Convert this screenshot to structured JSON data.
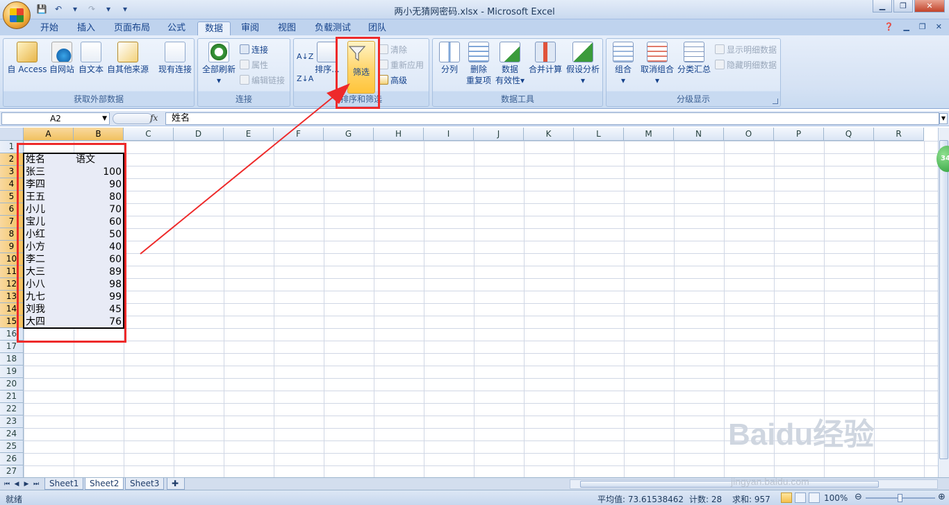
{
  "window": {
    "title": "两小无猜网密码.xlsx - Microsoft Excel",
    "controls": [
      "▁",
      "❐",
      "✕"
    ]
  },
  "ribbon_tabs": [
    "开始",
    "插入",
    "页面布局",
    "公式",
    "数据",
    "审阅",
    "视图",
    "负载测试",
    "团队"
  ],
  "active_tab": "数据",
  "groups": {
    "external": {
      "label": "获取外部数据",
      "buttons": [
        "自 Access",
        "自网站",
        "自文本",
        "自其他来源",
        "现有连接"
      ]
    },
    "connections": {
      "label": "连接",
      "refresh": "全部刷新",
      "connections": "连接",
      "properties": "属性",
      "edit_links": "编辑链接"
    },
    "sort_filter": {
      "label": "排序和筛选",
      "sort": "排序...",
      "filter": "筛选",
      "clear": "清除",
      "reapply": "重新应用",
      "advanced": "高级"
    },
    "data_tools": {
      "label": "数据工具",
      "split": "分列",
      "remove_dup_1": "删除",
      "remove_dup_2": "重复项",
      "validation_1": "数据",
      "validation_2": "有效性",
      "consolidate": "合并计算",
      "whatif": "假设分析"
    },
    "outline": {
      "label": "分级显示",
      "group": "组合",
      "ungroup": "取消组合",
      "subtotal": "分类汇总",
      "show_detail": "显示明细数据",
      "hide_detail": "隐藏明细数据"
    }
  },
  "formula_bar": {
    "name_box": "A2",
    "fx": "fx",
    "content": "姓名"
  },
  "columns": [
    "A",
    "B",
    "C",
    "D",
    "E",
    "F",
    "G",
    "H",
    "I",
    "J",
    "K",
    "L",
    "M",
    "N",
    "O",
    "P",
    "Q",
    "R"
  ],
  "rows": [
    "1",
    "2",
    "3",
    "4",
    "5",
    "6",
    "7",
    "8",
    "9",
    "10",
    "11",
    "12",
    "13",
    "14",
    "15",
    "16",
    "17",
    "18",
    "19",
    "20",
    "21",
    "22",
    "23",
    "24",
    "25",
    "26",
    "27"
  ],
  "table": {
    "header": [
      "姓名",
      "语文"
    ],
    "records": [
      [
        "张三",
        "100"
      ],
      [
        "李四",
        "90"
      ],
      [
        "王五",
        "80"
      ],
      [
        "小儿",
        "70"
      ],
      [
        "宝儿",
        "60"
      ],
      [
        "小红",
        "50"
      ],
      [
        "小方",
        "40"
      ],
      [
        "李二",
        "60"
      ],
      [
        "大三",
        "89"
      ],
      [
        "小八",
        "98"
      ],
      [
        "九七",
        "99"
      ],
      [
        "刘我",
        "45"
      ],
      [
        "大四",
        "76"
      ]
    ]
  },
  "sheets": [
    "Sheet1",
    "Sheet2",
    "Sheet3"
  ],
  "active_sheet": "Sheet2",
  "status": {
    "ready": "就绪",
    "average": "平均值: 73.61538462",
    "count": "计数: 28",
    "sum": "求和: 957",
    "zoom": "100%"
  },
  "side_badge": "34",
  "watermark": {
    "brand": "Baidu经验",
    "url": "jingyan.baidu.com"
  },
  "colors": {
    "accent_red": "#ee2a2a",
    "filter_highlight": "#ffd56a",
    "selected_header": "#f1c15f"
  }
}
